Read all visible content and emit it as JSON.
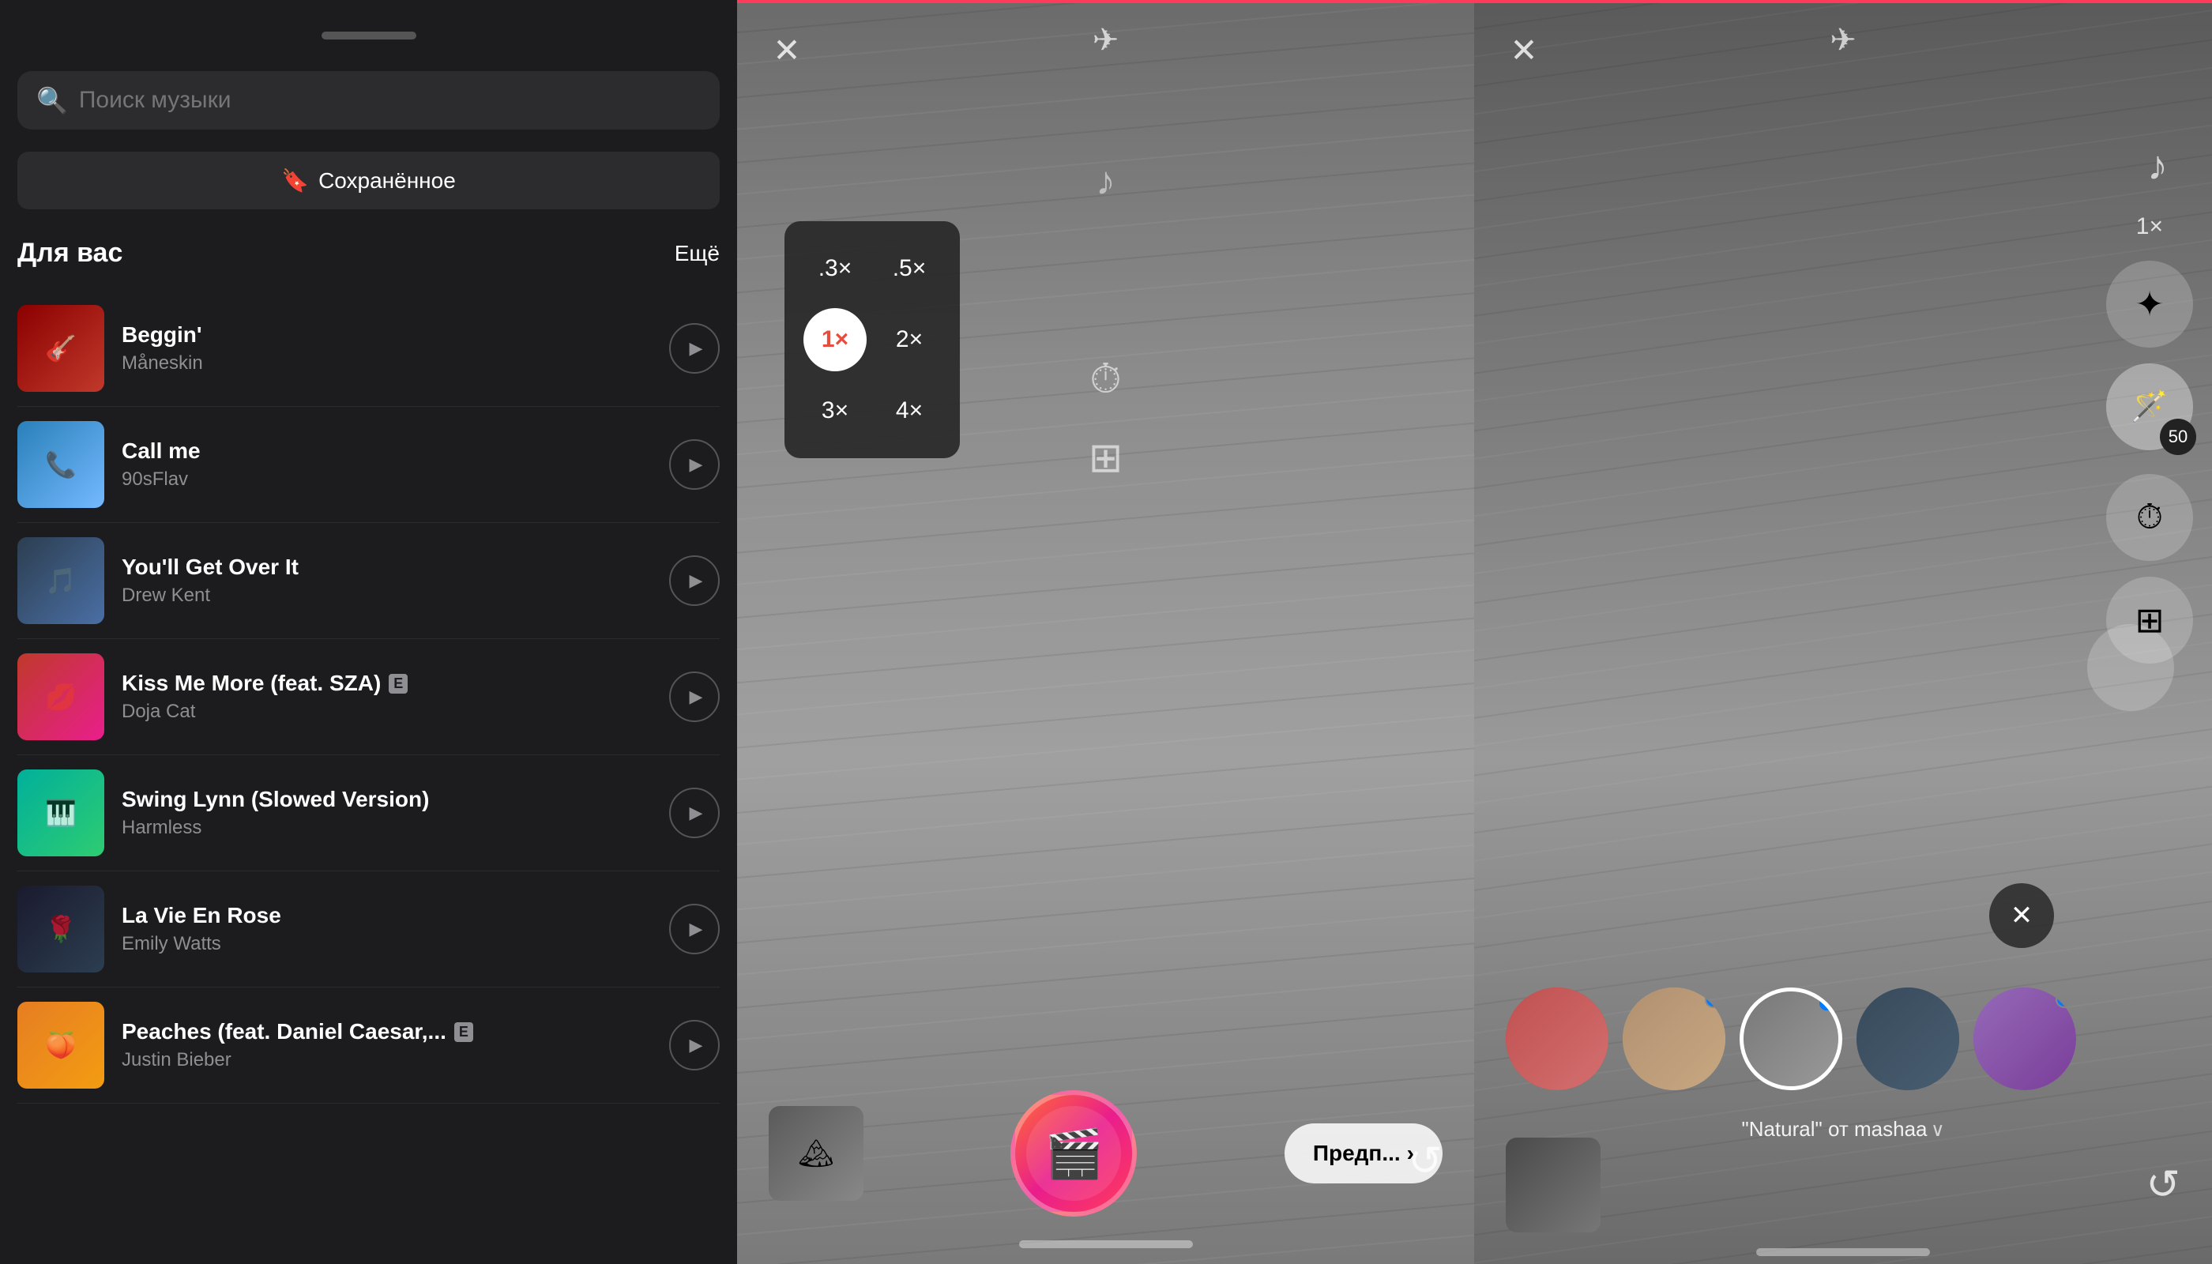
{
  "panel1": {
    "drag_handle": true,
    "search": {
      "placeholder": "Поиск музыки"
    },
    "saved_button": "Сохранённое",
    "section": {
      "title": "Для вас",
      "more": "Ещё"
    },
    "tracks": [
      {
        "id": "beggin",
        "title": "Beggin'",
        "artist": "Måneskin",
        "explicit": false,
        "art_class": "art-beggin-img",
        "art_emoji": "🎸"
      },
      {
        "id": "callme",
        "title": "Call me",
        "artist": "90sFlav",
        "explicit": false,
        "art_class": "art-callme-img",
        "art_emoji": "📞"
      },
      {
        "id": "youll",
        "title": "You'll Get Over It",
        "artist": "Drew Kent",
        "explicit": false,
        "art_class": "art-youll-img",
        "art_emoji": "🎵"
      },
      {
        "id": "kiss",
        "title": "Kiss Me More (feat. SZA)",
        "artist": "Doja Cat",
        "explicit": true,
        "art_class": "art-kiss-img",
        "art_emoji": "💋"
      },
      {
        "id": "swing",
        "title": "Swing Lynn (Slowed Version)",
        "artist": "Harmless",
        "explicit": false,
        "art_class": "art-swing-img",
        "art_emoji": "🎹"
      },
      {
        "id": "vie",
        "title": "La Vie En Rose",
        "artist": "Emily Watts",
        "explicit": false,
        "art_class": "art-vie-img",
        "art_emoji": "🌹"
      },
      {
        "id": "peaches",
        "title": "Peaches (feat. Daniel Caesar,...",
        "artist": "Justin Bieber",
        "explicit": true,
        "art_class": "art-peaches-img",
        "art_emoji": "🍑"
      }
    ]
  },
  "panel2": {
    "speeds": [
      {
        "label": ".3×",
        "active": false
      },
      {
        "label": ".5×",
        "active": false
      },
      {
        "label": "1×",
        "active": true
      },
      {
        "label": "2×",
        "active": false
      },
      {
        "label": "3×",
        "active": false
      },
      {
        "label": "4×",
        "active": false
      }
    ],
    "next_button": "Предп...",
    "icons": {
      "close": "✕",
      "flash": "✈",
      "music": "♪",
      "timer": "⏱",
      "layout": "⊞",
      "flip": "↺"
    }
  },
  "panel3": {
    "speed_label": "1×",
    "filter_label": "\"Natural\" от mashaa",
    "icons": {
      "close": "✕",
      "flash": "✈",
      "music": "♪",
      "sparkle": "✦",
      "wand": "🪄",
      "badge_number": "50",
      "timer": "⏱",
      "layout": "⊞",
      "flip": "↺"
    },
    "filters": [
      {
        "id": "f1",
        "active": false,
        "has_dot": false
      },
      {
        "id": "f2",
        "active": false,
        "has_dot": true
      },
      {
        "id": "f3",
        "active": true,
        "has_dot": true
      },
      {
        "id": "f4",
        "active": false,
        "has_dot": false
      },
      {
        "id": "f5",
        "active": false,
        "has_dot": true
      }
    ]
  }
}
